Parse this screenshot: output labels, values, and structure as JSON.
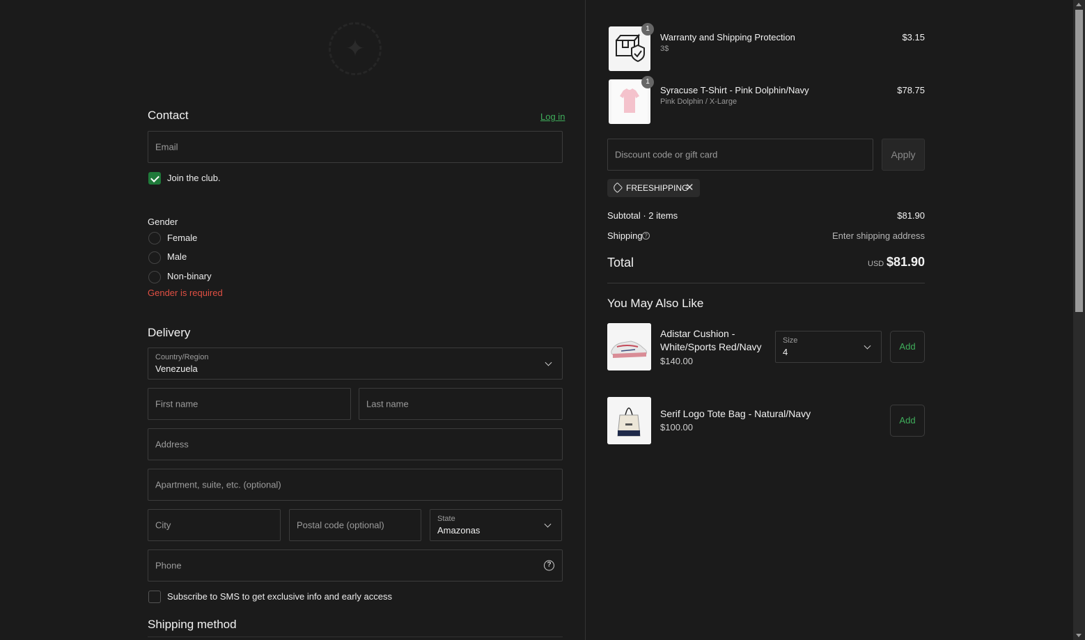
{
  "contact": {
    "heading": "Contact",
    "login_link": "Log in",
    "email_placeholder": "Email",
    "join_club_label": "Join the club.",
    "join_club_checked": true
  },
  "gender": {
    "label": "Gender",
    "options": [
      "Female",
      "Male",
      "Non-binary"
    ],
    "error": "Gender is required"
  },
  "delivery": {
    "heading": "Delivery",
    "country_label": "Country/Region",
    "country_value": "Venezuela",
    "first_name_placeholder": "First name",
    "last_name_placeholder": "Last name",
    "address_placeholder": "Address",
    "apartment_placeholder": "Apartment, suite, etc. (optional)",
    "city_placeholder": "City",
    "postal_placeholder": "Postal code (optional)",
    "state_label": "State",
    "state_value": "Amazonas",
    "phone_placeholder": "Phone",
    "sms_label": "Subscribe to SMS to get exclusive info and early access"
  },
  "shipping_method": {
    "heading": "Shipping method"
  },
  "cart": {
    "items": [
      {
        "title": "Warranty and Shipping Protection",
        "subtitle": "3$",
        "quantity": "1",
        "price": "$3.15",
        "icon": "package-shield-icon"
      },
      {
        "title": "Syracuse T-Shirt - Pink Dolphin/Navy",
        "subtitle": "Pink Dolphin / X-Large",
        "quantity": "1",
        "price": "$78.75",
        "icon": "tshirt-image"
      }
    ],
    "discount_placeholder": "Discount code or gift card",
    "apply_label": "Apply",
    "discount_tag": "FREESHIPPING",
    "subtotal_label": "Subtotal · 2 items",
    "subtotal_value": "$81.90",
    "shipping_label": "Shipping",
    "shipping_value": "Enter shipping address",
    "total_label": "Total",
    "currency": "USD",
    "total_value": "$81.90"
  },
  "recommendations": {
    "heading": "You May Also Like",
    "items": [
      {
        "title": "Adistar Cushion - White/Sports Red/Navy",
        "price": "$140.00",
        "size_label": "Size",
        "size_value": "4",
        "add_label": "Add"
      },
      {
        "title": "Serif Logo Tote Bag - Natural/Navy",
        "price": "$100.00",
        "add_label": "Add"
      }
    ]
  },
  "colors": {
    "accent_green": "#3fae5b",
    "error_red": "#e04f43",
    "background": "#1b1b1b"
  }
}
